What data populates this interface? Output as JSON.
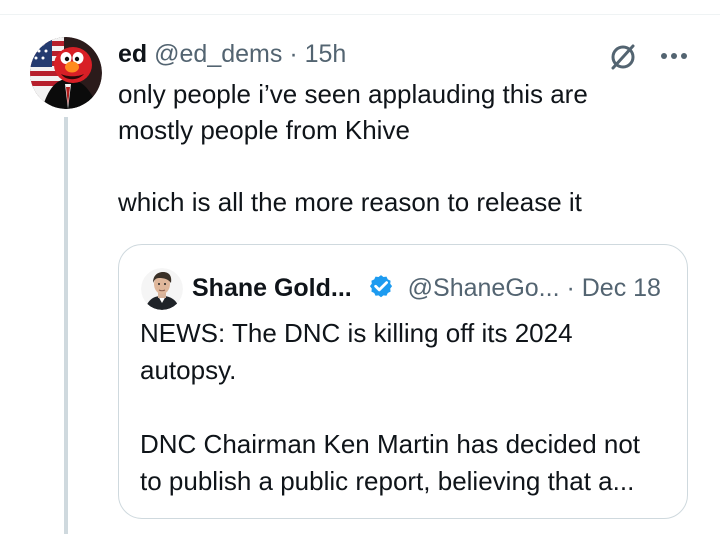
{
  "tweet": {
    "display_name": "ed",
    "handle": "@ed_dems",
    "separator": "·",
    "timestamp": "15h",
    "avatar_icon": "elmo-flag-avatar",
    "text": "only people i’ve seen applauding this are\nmostly people from Khive\n\nwhich is all the more reason to release it"
  },
  "actions": {
    "grok_icon": "grok-icon",
    "more_icon": "more-options-icon"
  },
  "quote": {
    "display_name": "Shane Gold...",
    "verified": true,
    "handle": "@ShaneGo...",
    "separator": "·",
    "date": "Dec 18",
    "avatar_icon": "man-portrait-avatar",
    "text": "NEWS: The DNC is killing off its 2024\nautopsy.\n\nDNC Chairman Ken Martin has decided not\nto publish a public report, believing that a..."
  },
  "colors": {
    "text": "#0f1419",
    "secondary": "#536471",
    "border": "#cfd9de",
    "verified": "#1d9bf0"
  }
}
